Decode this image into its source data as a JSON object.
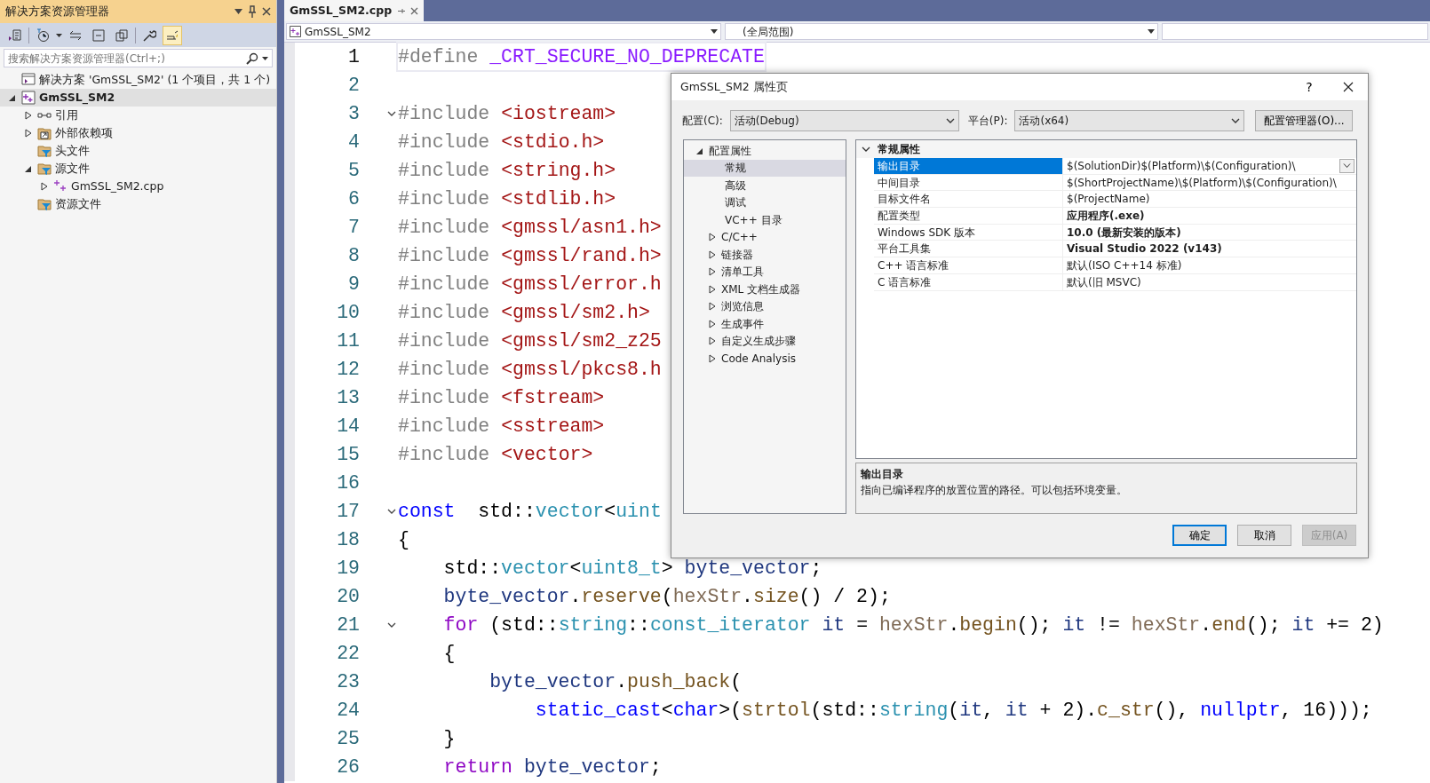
{
  "solution_explorer": {
    "title": "解决方案资源管理器",
    "search": {
      "placeholder": "搜索解决方案资源管理器(Ctrl+;)"
    },
    "tree": [
      {
        "label": "解决方案 'GmSSL_SM2' (1 个项目，共 1 个)",
        "kind": "solution",
        "selected": false,
        "bold": false,
        "children": [
          {
            "label": "GmSSL_SM2",
            "kind": "project",
            "selected": true,
            "bold": true,
            "expanded": true,
            "children": [
              {
                "label": "引用",
                "kind": "references",
                "selected": false,
                "bold": false,
                "expanded": false
              },
              {
                "label": "外部依赖项",
                "kind": "external",
                "selected": false,
                "bold": false,
                "expanded": false
              },
              {
                "label": "头文件",
                "kind": "filter",
                "selected": false,
                "bold": false
              },
              {
                "label": "源文件",
                "kind": "filter",
                "selected": false,
                "bold": false,
                "expanded": true,
                "children": [
                  {
                    "label": "GmSSL_SM2.cpp",
                    "kind": "cpp",
                    "selected": false,
                    "bold": false,
                    "expanded": false
                  }
                ]
              },
              {
                "label": "资源文件",
                "kind": "filter",
                "selected": false,
                "bold": false
              }
            ]
          }
        ]
      }
    ]
  },
  "tabs": [
    {
      "label": "GmSSL_SM2.cpp",
      "selected": true
    }
  ],
  "nav_bar": {
    "project": "GmSSL_SM2",
    "scope": "(全局范围)"
  },
  "code_lines": [
    {
      "number": "1",
      "current": true,
      "foldable": false,
      "tokens": [
        {
          "kind": "pp",
          "text": "#define "
        },
        {
          "kind": "macro",
          "text": "_CRT_SECURE_NO_DEPRECATE"
        }
      ]
    },
    {
      "number": "2",
      "current": false,
      "foldable": false
    },
    {
      "number": "3",
      "current": false,
      "foldable": true,
      "tokens": [
        {
          "kind": "pp",
          "text": "#include "
        },
        {
          "kind": "str",
          "text": "<iostream>"
        }
      ]
    },
    {
      "number": "4",
      "current": false,
      "foldable": false,
      "tokens": [
        {
          "kind": "pp",
          "text": "#include "
        },
        {
          "kind": "str",
          "text": "<stdio.h>"
        }
      ]
    },
    {
      "number": "5",
      "current": false,
      "foldable": false,
      "tokens": [
        {
          "kind": "pp",
          "text": "#include "
        },
        {
          "kind": "str",
          "text": "<string.h>"
        }
      ]
    },
    {
      "number": "6",
      "current": false,
      "foldable": false,
      "tokens": [
        {
          "kind": "pp",
          "text": "#include "
        },
        {
          "kind": "str",
          "text": "<stdlib.h>"
        }
      ]
    },
    {
      "number": "7",
      "current": false,
      "foldable": false,
      "tokens": [
        {
          "kind": "pp",
          "text": "#include "
        },
        {
          "kind": "str",
          "text": "<gmssl/asn1.h>"
        }
      ]
    },
    {
      "number": "8",
      "current": false,
      "foldable": false,
      "tokens": [
        {
          "kind": "pp",
          "text": "#include "
        },
        {
          "kind": "str",
          "text": "<gmssl/rand.h>"
        }
      ]
    },
    {
      "number": "9",
      "current": false,
      "foldable": false,
      "tokens": [
        {
          "kind": "pp",
          "text": "#include "
        },
        {
          "kind": "str",
          "text": "<gmssl/error.h"
        }
      ]
    },
    {
      "number": "10",
      "current": false,
      "foldable": false,
      "tokens": [
        {
          "kind": "pp",
          "text": "#include "
        },
        {
          "kind": "str",
          "text": "<gmssl/sm2.h>"
        }
      ]
    },
    {
      "number": "11",
      "current": false,
      "foldable": false,
      "tokens": [
        {
          "kind": "pp",
          "text": "#include "
        },
        {
          "kind": "str",
          "text": "<gmssl/sm2_z25"
        }
      ]
    },
    {
      "number": "12",
      "current": false,
      "foldable": false,
      "tokens": [
        {
          "kind": "pp",
          "text": "#include "
        },
        {
          "kind": "str",
          "text": "<gmssl/pkcs8.h"
        }
      ]
    },
    {
      "number": "13",
      "current": false,
      "foldable": false,
      "tokens": [
        {
          "kind": "pp",
          "text": "#include "
        },
        {
          "kind": "str",
          "text": "<fstream>"
        }
      ]
    },
    {
      "number": "14",
      "current": false,
      "foldable": false,
      "tokens": [
        {
          "kind": "pp",
          "text": "#include "
        },
        {
          "kind": "str",
          "text": "<sstream>"
        }
      ]
    },
    {
      "number": "15",
      "current": false,
      "foldable": false,
      "tokens": [
        {
          "kind": "pp",
          "text": "#include "
        },
        {
          "kind": "str",
          "text": "<vector>"
        }
      ]
    },
    {
      "number": "16",
      "current": false,
      "foldable": false
    },
    {
      "number": "17",
      "current": false,
      "foldable": true,
      "tokens": [
        {
          "kind": "kw",
          "text": "const"
        },
        {
          "kind": "plain",
          "text": "  std::"
        },
        {
          "kind": "type",
          "text": "vector"
        },
        {
          "kind": "plain",
          "text": "<"
        },
        {
          "kind": "type",
          "text": "uint"
        }
      ]
    },
    {
      "number": "18",
      "current": false,
      "foldable": false,
      "tokens": [
        {
          "kind": "plain",
          "text": "{"
        }
      ]
    },
    {
      "number": "19",
      "current": false,
      "foldable": false,
      "kind": "indented",
      "tokens": [
        {
          "kind": "plain",
          "text": "std::"
        },
        {
          "kind": "type",
          "text": "vector"
        },
        {
          "kind": "plain",
          "text": "<"
        },
        {
          "kind": "type",
          "text": "uint8_t"
        },
        {
          "kind": "plain",
          "text": "> "
        },
        {
          "kind": "var",
          "text": "byte_vector"
        },
        {
          "kind": "plain",
          "text": ";"
        }
      ]
    },
    {
      "number": "20",
      "current": false,
      "foldable": false,
      "kind": "indented",
      "tokens": [
        {
          "kind": "var",
          "text": "byte_vector"
        },
        {
          "kind": "plain",
          "text": "."
        },
        {
          "kind": "fn",
          "text": "reserve"
        },
        {
          "kind": "plain",
          "text": "("
        },
        {
          "kind": "param",
          "text": "hexStr"
        },
        {
          "kind": "plain",
          "text": "."
        },
        {
          "kind": "fn",
          "text": "size"
        },
        {
          "kind": "plain",
          "text": "() / 2);"
        }
      ]
    },
    {
      "number": "21",
      "current": false,
      "foldable": true,
      "kind": "indented",
      "tokens": [
        {
          "kind": "ctl",
          "text": "for"
        },
        {
          "kind": "plain",
          "text": " (std::"
        },
        {
          "kind": "type",
          "text": "string"
        },
        {
          "kind": "plain",
          "text": "::"
        },
        {
          "kind": "type",
          "text": "const_iterator"
        },
        {
          "kind": "var",
          "text": " it"
        },
        {
          "kind": "plain",
          "text": " = "
        },
        {
          "kind": "param",
          "text": "hexStr"
        },
        {
          "kind": "plain",
          "text": "."
        },
        {
          "kind": "fn",
          "text": "begin"
        },
        {
          "kind": "plain",
          "text": "(); "
        },
        {
          "kind": "var",
          "text": "it"
        },
        {
          "kind": "plain",
          "text": " != "
        },
        {
          "kind": "param",
          "text": "hexStr"
        },
        {
          "kind": "plain",
          "text": "."
        },
        {
          "kind": "fn",
          "text": "end"
        },
        {
          "kind": "plain",
          "text": "(); "
        },
        {
          "kind": "var",
          "text": "it"
        },
        {
          "kind": "plain",
          "text": " += 2)"
        }
      ]
    },
    {
      "number": "22",
      "current": false,
      "foldable": false,
      "kind": "indented",
      "tokens": [
        {
          "kind": "plain",
          "text": "{"
        }
      ]
    },
    {
      "number": "23",
      "current": false,
      "foldable": false,
      "kind": "nested",
      "tokens": [
        {
          "kind": "var",
          "text": "byte_vector"
        },
        {
          "kind": "plain",
          "text": "."
        },
        {
          "kind": "fn",
          "text": "push_back"
        },
        {
          "kind": "plain",
          "text": "("
        }
      ]
    },
    {
      "number": "24",
      "current": false,
      "foldable": false,
      "kind": "continuation",
      "tokens": [
        {
          "kind": "kw",
          "text": "static_cast"
        },
        {
          "kind": "plain",
          "text": "<"
        },
        {
          "kind": "kw",
          "text": "char"
        },
        {
          "kind": "plain",
          "text": ">("
        },
        {
          "kind": "fn",
          "text": "strtol"
        },
        {
          "kind": "plain",
          "text": "(std::"
        },
        {
          "kind": "type",
          "text": "string"
        },
        {
          "kind": "plain",
          "text": "("
        },
        {
          "kind": "var",
          "text": "it"
        },
        {
          "kind": "plain",
          "text": ", "
        },
        {
          "kind": "var",
          "text": "it"
        },
        {
          "kind": "plain",
          "text": " + 2)."
        },
        {
          "kind": "fn",
          "text": "c_str"
        },
        {
          "kind": "plain",
          "text": "(), "
        },
        {
          "kind": "kw",
          "text": "nullptr"
        },
        {
          "kind": "plain",
          "text": ", 16)));"
        }
      ]
    },
    {
      "number": "25",
      "current": false,
      "foldable": false,
      "kind": "indented",
      "tokens": [
        {
          "kind": "plain",
          "text": "}"
        }
      ]
    },
    {
      "number": "26",
      "current": false,
      "foldable": false,
      "kind": "indented",
      "tokens": [
        {
          "kind": "ctl",
          "text": "return"
        },
        {
          "kind": "var",
          "text": " byte_vector"
        },
        {
          "kind": "plain",
          "text": ";"
        }
      ]
    }
  ],
  "dialog": {
    "title": "GmSSL_SM2 属性页",
    "help": "?",
    "config_label": "配置(C):",
    "config_value": "活动(Debug)",
    "platform_label": "平台(P):",
    "platform_value": "活动(x64)",
    "manager_button": "配置管理器(O)...",
    "nav_tree": [
      {
        "label": "配置属性",
        "selected": false,
        "expanded": true,
        "children": [
          {
            "label": "常规",
            "selected": true
          },
          {
            "label": "高级",
            "selected": false
          },
          {
            "label": "调试",
            "selected": false
          },
          {
            "label": "VC++ 目录",
            "selected": false
          },
          {
            "label": "C/C++",
            "selected": false,
            "expanded": false
          },
          {
            "label": "链接器",
            "selected": false,
            "expanded": false
          },
          {
            "label": "清单工具",
            "selected": false,
            "expanded": false
          },
          {
            "label": "XML 文档生成器",
            "selected": false,
            "expanded": false
          },
          {
            "label": "浏览信息",
            "selected": false,
            "expanded": false
          },
          {
            "label": "生成事件",
            "selected": false,
            "expanded": false
          },
          {
            "label": "自定义生成步骤",
            "selected": false,
            "expanded": false
          },
          {
            "label": "Code Analysis",
            "selected": false,
            "expanded": false
          }
        ]
      }
    ],
    "grid": {
      "category": "常规属性",
      "expanded": true,
      "rows": [
        {
          "name": "输出目录",
          "value": "$(SolutionDir)$(Platform)\\$(Configuration)\\",
          "bold": false,
          "selected": true
        },
        {
          "name": "中间目录",
          "value": "$(ShortProjectName)\\$(Platform)\\$(Configuration)\\",
          "bold": false,
          "selected": false
        },
        {
          "name": "目标文件名",
          "value": "$(ProjectName)",
          "bold": false,
          "selected": false
        },
        {
          "name": "配置类型",
          "value": "应用程序(.exe)",
          "bold": true,
          "selected": false
        },
        {
          "name": "Windows SDK 版本",
          "value": "10.0 (最新安装的版本)",
          "bold": true,
          "selected": false
        },
        {
          "name": "平台工具集",
          "value": "Visual Studio 2022 (v143)",
          "bold": true,
          "selected": false
        },
        {
          "name": "C++ 语言标准",
          "value": "默认(ISO C++14 标准)",
          "bold": false,
          "selected": false
        },
        {
          "name": "C 语言标准",
          "value": "默认(旧 MSVC)",
          "bold": false,
          "selected": false
        }
      ]
    },
    "description": {
      "title": "输出目录",
      "text": "指向已编译程序的放置位置的路径。可以包括环境变量。"
    },
    "buttons": [
      {
        "label": "确定",
        "kind": "default",
        "disabled": false
      },
      {
        "label": "取消",
        "kind": "normal",
        "disabled": false
      },
      {
        "label": "应用(A)",
        "kind": "normal",
        "disabled": true
      }
    ]
  }
}
